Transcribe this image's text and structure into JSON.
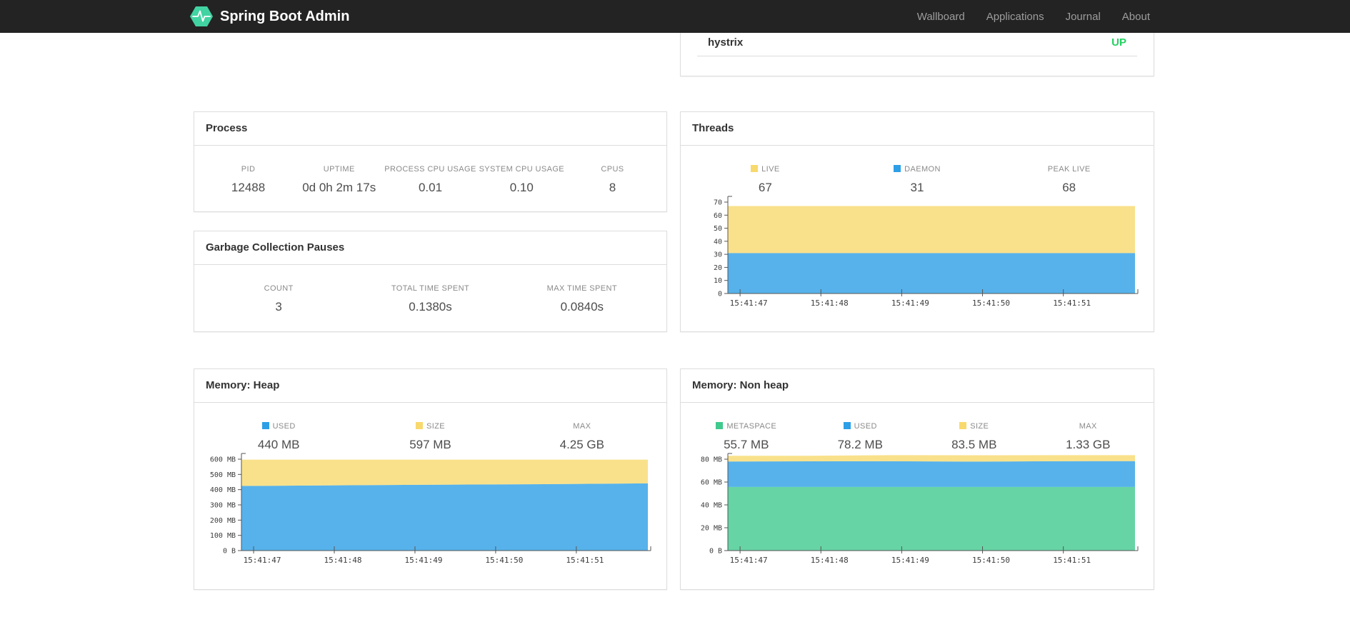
{
  "navbar": {
    "brand": "Spring Boot Admin",
    "links": [
      "Wallboard",
      "Applications",
      "Journal",
      "About"
    ]
  },
  "health": {
    "application": "hystrix",
    "status": "UP"
  },
  "colors": {
    "status_up": "#23d160",
    "navbar_bg": "#232323",
    "logo_green": "#42d3a2",
    "series_yellow": "#f8d96e",
    "series_blue": "#2d9fe6",
    "series_green": "#41c98e"
  },
  "panels": {
    "process": {
      "title": "Process",
      "stats": [
        {
          "label": "PID",
          "value": "12488"
        },
        {
          "label": "UPTIME",
          "value": "0d 0h 2m 17s"
        },
        {
          "label": "PROCESS CPU USAGE",
          "value": "0.01"
        },
        {
          "label": "SYSTEM CPU USAGE",
          "value": "0.10"
        },
        {
          "label": "CPUS",
          "value": "8"
        }
      ]
    },
    "gc": {
      "title": "Garbage Collection Pauses",
      "stats": [
        {
          "label": "COUNT",
          "value": "3"
        },
        {
          "label": "TOTAL TIME SPENT",
          "value": "0.1380s"
        },
        {
          "label": "MAX TIME SPENT",
          "value": "0.0840s"
        }
      ]
    },
    "threads": {
      "title": "Threads",
      "stats": [
        {
          "label": "LIVE",
          "value": "67",
          "legend_color": "#f8d96e"
        },
        {
          "label": "DAEMON",
          "value": "31",
          "legend_color": "#2d9fe6"
        },
        {
          "label": "PEAK LIVE",
          "value": "68"
        }
      ]
    },
    "heap": {
      "title": "Memory: Heap",
      "stats": [
        {
          "label": "USED",
          "value": "440 MB",
          "legend_color": "#2d9fe6"
        },
        {
          "label": "SIZE",
          "value": "597 MB",
          "legend_color": "#f8d96e"
        },
        {
          "label": "MAX",
          "value": "4.25 GB"
        }
      ]
    },
    "nonheap": {
      "title": "Memory: Non heap",
      "stats": [
        {
          "label": "METASPACE",
          "value": "55.7 MB",
          "legend_color": "#41c98e"
        },
        {
          "label": "USED",
          "value": "78.2 MB",
          "legend_color": "#2d9fe6"
        },
        {
          "label": "SIZE",
          "value": "83.5 MB",
          "legend_color": "#f8d96e"
        },
        {
          "label": "MAX",
          "value": "1.33 GB"
        }
      ]
    }
  },
  "chart_data": [
    {
      "id": "threads",
      "type": "area",
      "stacked": true,
      "title": "Threads",
      "x_labels": [
        "15:41:47",
        "15:41:48",
        "15:41:49",
        "15:41:50",
        "15:41:51"
      ],
      "ylim": [
        0,
        70
      ],
      "grid": false,
      "legend_position": "above",
      "yticks": [
        {
          "v": 0,
          "label": "0"
        },
        {
          "v": 10,
          "label": "10"
        },
        {
          "v": 20,
          "label": "20"
        },
        {
          "v": 30,
          "label": "30"
        },
        {
          "v": 40,
          "label": "40"
        },
        {
          "v": 50,
          "label": "50"
        },
        {
          "v": 60,
          "label": "60"
        },
        {
          "v": 70,
          "label": "70"
        }
      ],
      "series": [
        {
          "name": "daemon",
          "color": "#2d9fe6",
          "top": [
            31,
            31,
            31,
            31,
            31,
            31
          ]
        },
        {
          "name": "live",
          "color": "#f8d96e",
          "top": [
            67,
            67,
            67,
            67,
            67,
            67
          ]
        }
      ]
    },
    {
      "id": "heap",
      "type": "area",
      "stacked": true,
      "title": "Memory: Heap",
      "x_labels": [
        "15:41:47",
        "15:41:48",
        "15:41:49",
        "15:41:50",
        "15:41:51"
      ],
      "ylim": [
        0,
        600
      ],
      "grid": false,
      "legend_position": "above",
      "yticks": [
        {
          "v": 0,
          "label": "0 B"
        },
        {
          "v": 100,
          "label": "100 MB"
        },
        {
          "v": 200,
          "label": "200 MB"
        },
        {
          "v": 300,
          "label": "300 MB"
        },
        {
          "v": 400,
          "label": "400 MB"
        },
        {
          "v": 500,
          "label": "500 MB"
        },
        {
          "v": 600,
          "label": "600 MB"
        }
      ],
      "series": [
        {
          "name": "used",
          "color": "#2d9fe6",
          "top": [
            424,
            428,
            431,
            434,
            437,
            441
          ]
        },
        {
          "name": "size",
          "color": "#f8d96e",
          "top": [
            597,
            597,
            597,
            597,
            597,
            597
          ]
        }
      ]
    },
    {
      "id": "nonheap",
      "type": "area",
      "stacked": true,
      "title": "Memory: Non heap",
      "x_labels": [
        "15:41:47",
        "15:41:48",
        "15:41:49",
        "15:41:50",
        "15:41:51"
      ],
      "ylim": [
        0,
        80
      ],
      "grid": false,
      "legend_position": "above",
      "yticks": [
        {
          "v": 0,
          "label": "0 B"
        },
        {
          "v": 20,
          "label": "20 MB"
        },
        {
          "v": 40,
          "label": "40 MB"
        },
        {
          "v": 60,
          "label": "60 MB"
        },
        {
          "v": 80,
          "label": "80 MB"
        }
      ],
      "series": [
        {
          "name": "metaspace",
          "color": "#41c98e",
          "top": [
            55.7,
            55.7,
            55.7,
            55.7,
            55.7,
            55.7
          ]
        },
        {
          "name": "used",
          "color": "#2d9fe6",
          "top": [
            78.0,
            78.1,
            78.2,
            77.9,
            78.2,
            78.3
          ]
        },
        {
          "name": "size",
          "color": "#f8d96e",
          "top": [
            83.0,
            83.0,
            83.5,
            83.4,
            83.5,
            83.5
          ]
        }
      ]
    }
  ]
}
